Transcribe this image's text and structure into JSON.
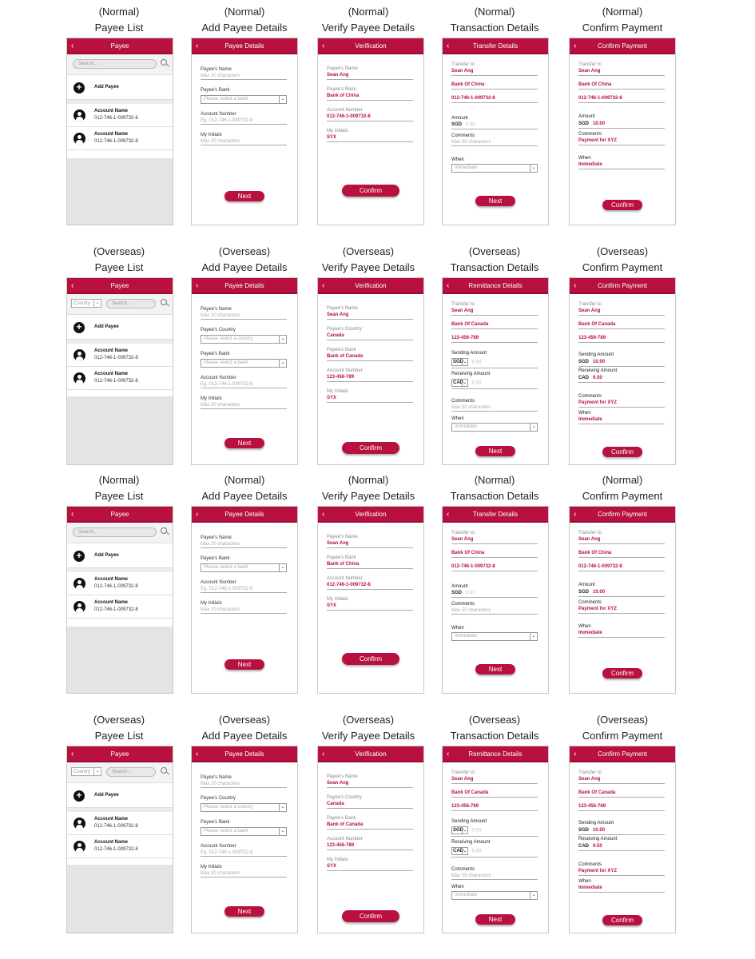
{
  "rows": [
    {
      "captions": [
        {
          "mode": "(Normal)",
          "title": "Payee List"
        },
        {
          "mode": "(Normal)",
          "title": "Add Payee Details"
        },
        {
          "mode": "(Normal)",
          "title": "Verify Payee Details"
        },
        {
          "mode": "(Normal)",
          "title": "Transaction Details"
        },
        {
          "mode": "(Normal)",
          "title": "Confirm Payment"
        }
      ],
      "list": {
        "header": "Payee",
        "search_placeholder": "Search...",
        "country_placeholder": "",
        "add_label": "Add Payee",
        "accounts": [
          {
            "name": "Account Name",
            "number": "012-746-1-009732-8"
          },
          {
            "name": "Account Name",
            "number": "012-746-1-009732-8"
          }
        ]
      },
      "add": {
        "header": "Payee Details",
        "name_label": "Payee's Name",
        "name_ph": "Max 20 characters",
        "country_label": "",
        "country_ph": "",
        "bank_label": "Payee's Bank",
        "bank_ph": "Please select a bank",
        "acct_label": "Account Number",
        "acct_ph": "Eg. 012-746-1-009732-8",
        "init_label": "My Initials",
        "init_ph": "Max 20 characters",
        "button": "Next"
      },
      "verify": {
        "header": "Verification",
        "name_label": "Payee's Name",
        "name": "Sean Ang",
        "country_label": "",
        "country": "",
        "bank_label": "Payee's Bank",
        "bank": "Bank of China",
        "acct_label": "Account Number",
        "acct": "012-746-1-009732-8",
        "init_label": "My Initials",
        "init": "SYX",
        "button": "Confirm"
      },
      "txn": {
        "header": "Transfer Details",
        "to_label": "Transfer to",
        "payee": "Sean Ang",
        "bank": "Bank Of China",
        "acct": "012-746-1-009732-8",
        "amount_label": "Amount",
        "currency": "SGD",
        "amount_ph": "0.00",
        "send_label": "",
        "send_cur": "",
        "send_ph": "",
        "recv_label": "",
        "recv_cur": "",
        "recv_ph": "",
        "comments_label": "Comments",
        "comments_ph": "Max 50 characters",
        "when_label": "When",
        "when_ph": "Immediate",
        "button": "Next"
      },
      "confirm": {
        "header": "Confirm Payment",
        "to_label": "Transfer to",
        "payee": "Sean Ang",
        "bank": "Bank Of China",
        "acct": "012-746-1-009732-8",
        "amount_label": "Amount",
        "currency": "SGD",
        "amount": "10.00",
        "send_label": "",
        "send_cur": "",
        "send_amt": "",
        "recv_label": "",
        "recv_cur": "",
        "recv_amt": "",
        "comments_label": "Comments",
        "comments": "Payment for XYZ",
        "when_label": "When",
        "when": "Immediate",
        "button": "Confirm"
      }
    },
    {
      "captions": [
        {
          "mode": "(Overseas)",
          "title": "Payee List"
        },
        {
          "mode": "(Overseas)",
          "title": "Add Payee Details"
        },
        {
          "mode": "(Overseas)",
          "title": "Verify Payee Details"
        },
        {
          "mode": "(Overseas)",
          "title": "Transaction Details"
        },
        {
          "mode": "(Overseas)",
          "title": "Confirm Payment"
        }
      ],
      "list": {
        "header": "Payee",
        "search_placeholder": "Search...",
        "country_placeholder": "Country",
        "add_label": "Add Payee",
        "accounts": [
          {
            "name": "Account Name",
            "number": "012-746-1-009732-8"
          },
          {
            "name": "Account Name",
            "number": "012-746-1-009732-8"
          }
        ]
      },
      "add": {
        "header": "Payee Details",
        "name_label": "Payee's Name",
        "name_ph": "Max 20 characters",
        "country_label": "Payee's Country",
        "country_ph": "Please select a country",
        "bank_label": "Payee's Bank",
        "bank_ph": "Please select a bank",
        "acct_label": "Account Number",
        "acct_ph": "Eg. 012-746-1-009732-8",
        "init_label": "My Initials",
        "init_ph": "Max 20 characters",
        "button": "Next"
      },
      "verify": {
        "header": "Verification",
        "name_label": "Payee's Name",
        "name": "Sean Ang",
        "country_label": "Payee's Country",
        "country": "Canada",
        "bank_label": "Payee's Bank",
        "bank": "Bank of Canada",
        "acct_label": "Account Number",
        "acct": "123-456-789",
        "init_label": "My Initials",
        "init": "SYX",
        "button": "Confirm"
      },
      "txn": {
        "header": "Remittance Details",
        "to_label": "Transfer to",
        "payee": "Sean Ang",
        "bank": "Bank Of Canada",
        "acct": "123-456-789",
        "amount_label": "",
        "currency": "",
        "amount_ph": "",
        "send_label": "Sending Amount",
        "send_cur": "SGD",
        "send_ph": "0.00",
        "recv_label": "Receiving Amount",
        "recv_cur": "CAD",
        "recv_ph": "0.00",
        "comments_label": "Comments",
        "comments_ph": "Max 50 characters",
        "when_label": "When",
        "when_ph": "Immediate",
        "button": "Next"
      },
      "confirm": {
        "header": "Confirm Payment",
        "to_label": "Transfer to",
        "payee": "Sean Ang",
        "bank": "Bank Of Canada",
        "acct": "123-456-789",
        "amount_label": "",
        "currency": "",
        "amount": "",
        "send_label": "Sending Amount",
        "send_cur": "SGD",
        "send_amt": "10.00",
        "recv_label": "Receiving Amount",
        "recv_cur": "CAD",
        "recv_amt": "9.50",
        "comments_label": "Comments",
        "comments": "Payment for XYZ",
        "when_label": "When",
        "when": "Immediate",
        "button": "Confirm"
      }
    },
    {
      "captions": [
        {
          "mode": "(Normal)",
          "title": "Payee List"
        },
        {
          "mode": "(Normal)",
          "title": "Add Payee Details"
        },
        {
          "mode": "(Normal)",
          "title": "Verify Payee Details"
        },
        {
          "mode": "(Normal)",
          "title": "Transaction Details"
        },
        {
          "mode": "(Normal)",
          "title": "Confirm Payment"
        }
      ],
      "list": {
        "header": "Payee",
        "search_placeholder": "Search...",
        "country_placeholder": "",
        "add_label": "Add Payee",
        "accounts": [
          {
            "name": "Account Name",
            "number": "012-746-1-009732-8"
          },
          {
            "name": "Account Name",
            "number": "012-746-1-009732-8"
          }
        ]
      },
      "add": {
        "header": "Payee Details",
        "name_label": "Payee's Name",
        "name_ph": "Max 20 characters",
        "country_label": "",
        "country_ph": "",
        "bank_label": "Payee's Bank",
        "bank_ph": "Please select a bank",
        "acct_label": "Account Number",
        "acct_ph": "Eg. 012-746-1-009732-8",
        "init_label": "My Initials",
        "init_ph": "Max 20 characters",
        "button": "Next"
      },
      "verify": {
        "header": "Verification",
        "name_label": "Payee's Name",
        "name": "Sean Ang",
        "country_label": "",
        "country": "",
        "bank_label": "Payee's Bank",
        "bank": "Bank of China",
        "acct_label": "Account Number",
        "acct": "012-746-1-009732-8",
        "init_label": "My Initials",
        "init": "SYX",
        "button": "Confirm"
      },
      "txn": {
        "header": "Transfer Details",
        "to_label": "Transfer to",
        "payee": "Sean Ang",
        "bank": "Bank Of China",
        "acct": "012-746-1-009732-8",
        "amount_label": "Amount",
        "currency": "SGD",
        "amount_ph": "0.00",
        "send_label": "",
        "send_cur": "",
        "send_ph": "",
        "recv_label": "",
        "recv_cur": "",
        "recv_ph": "",
        "comments_label": "Comments",
        "comments_ph": "Max 50 characters",
        "when_label": "When",
        "when_ph": "Immediate",
        "button": "Next"
      },
      "confirm": {
        "header": "Confirm Payment",
        "to_label": "Transfer to",
        "payee": "Sean Ang",
        "bank": "Bank Of China",
        "acct": "012-746-1-009732-8",
        "amount_label": "Amount",
        "currency": "SGD",
        "amount": "10.00",
        "send_label": "",
        "send_cur": "",
        "send_amt": "",
        "recv_label": "",
        "recv_cur": "",
        "recv_amt": "",
        "comments_label": "Comments",
        "comments": "Payment for XYZ",
        "when_label": "When",
        "when": "Immediate",
        "button": "Confirm"
      }
    },
    {
      "captions": [
        {
          "mode": "(Overseas)",
          "title": "Payee List"
        },
        {
          "mode": "(Overseas)",
          "title": "Add Payee Details"
        },
        {
          "mode": "(Overseas)",
          "title": "Verify Payee Details"
        },
        {
          "mode": "(Overseas)",
          "title": "Transaction Details"
        },
        {
          "mode": "(Overseas)",
          "title": "Confirm Payment"
        }
      ],
      "list": {
        "header": "Payee",
        "search_placeholder": "Search...",
        "country_placeholder": "Country",
        "add_label": "Add Payee",
        "accounts": [
          {
            "name": "Account Name",
            "number": "012-746-1-009732-8"
          },
          {
            "name": "Account Name",
            "number": "012-746-1-009732-8"
          }
        ]
      },
      "add": {
        "header": "Payee Details",
        "name_label": "Payee's Name",
        "name_ph": "Max 20 characters",
        "country_label": "Payee's Country",
        "country_ph": "Please select a country",
        "bank_label": "Payee's Bank",
        "bank_ph": "Please select a bank",
        "acct_label": "Account Number",
        "acct_ph": "Eg. 012-746-1-009732-8",
        "init_label": "My Initials",
        "init_ph": "Max 20 characters",
        "button": "Next"
      },
      "verify": {
        "header": "Verification",
        "name_label": "Payee's Name",
        "name": "Sean Ang",
        "country_label": "Payee's Country",
        "country": "Canada",
        "bank_label": "Payee's Bank",
        "bank": "Bank of Canada",
        "acct_label": "Account Number",
        "acct": "123-456-789",
        "init_label": "My Initials",
        "init": "SYX",
        "button": "Confirm"
      },
      "txn": {
        "header": "Remittance Details",
        "to_label": "Transfer to",
        "payee": "Sean Ang",
        "bank": "Bank Of Canada",
        "acct": "123-456-789",
        "amount_label": "",
        "currency": "",
        "amount_ph": "",
        "send_label": "Sending Amount",
        "send_cur": "SGD",
        "send_ph": "0.00",
        "recv_label": "Receiving Amount",
        "recv_cur": "CAD",
        "recv_ph": "0.00",
        "comments_label": "Comments",
        "comments_ph": "Max 50 characters",
        "when_label": "When",
        "when_ph": "Immediate",
        "button": "Next"
      },
      "confirm": {
        "header": "Confirm Payment",
        "to_label": "Transfer to",
        "payee": "Sean Ang",
        "bank": "Bank Of Canada",
        "acct": "123-456-789",
        "amount_label": "",
        "currency": "",
        "amount": "",
        "send_label": "Sending Amount",
        "send_cur": "SGD",
        "send_amt": "10.00",
        "recv_label": "Receiving Amount",
        "recv_cur": "CAD",
        "recv_amt": "9.50",
        "comments_label": "Comments",
        "comments": "Payment for XYZ",
        "when_label": "When",
        "when": "Immediate",
        "button": "Confirm"
      }
    }
  ],
  "icons": {
    "back": "back-arrow-icon",
    "search": "search-icon",
    "add": "plus-circle-icon",
    "account": "account-circle-icon",
    "dropdown": "chevron-down-icon"
  },
  "colors": {
    "brand": "#b8103f",
    "value_text": "#b8103f",
    "list_background": "#e4e4e4"
  }
}
